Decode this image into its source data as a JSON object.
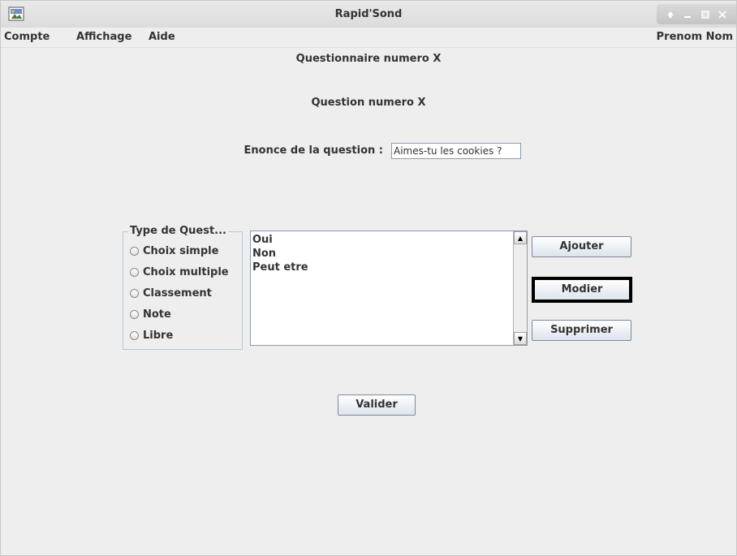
{
  "window": {
    "title": "Rapid'Sond",
    "icons": {
      "app": "app-icon",
      "up": "arrow-up-icon",
      "minimize": "minimize-icon",
      "maximize": "maximize-icon",
      "close": "close-icon"
    }
  },
  "menubar": {
    "items": [
      "Compte",
      "Affichage",
      "Aide"
    ],
    "user": "Prenom Nom"
  },
  "form": {
    "questionnaire_title": "Questionnaire numero X",
    "question_title": "Question numero X",
    "enonce_label": "Enonce de la question :",
    "enonce_value": "Aimes-tu les cookies ?"
  },
  "type_group": {
    "legend": "Type de Quest...",
    "options": [
      "Choix simple",
      "Choix multiple",
      "Classement",
      "Note",
      "Libre"
    ]
  },
  "answers": {
    "items": [
      "Oui",
      "Non",
      "Peut etre"
    ]
  },
  "buttons": {
    "ajouter": "Ajouter",
    "modier": "Modier",
    "supprimer": "Supprimer",
    "valider": "Valider"
  },
  "colors": {
    "background": "#eeeeee",
    "text": "#333333",
    "focus_border": "#000000"
  }
}
